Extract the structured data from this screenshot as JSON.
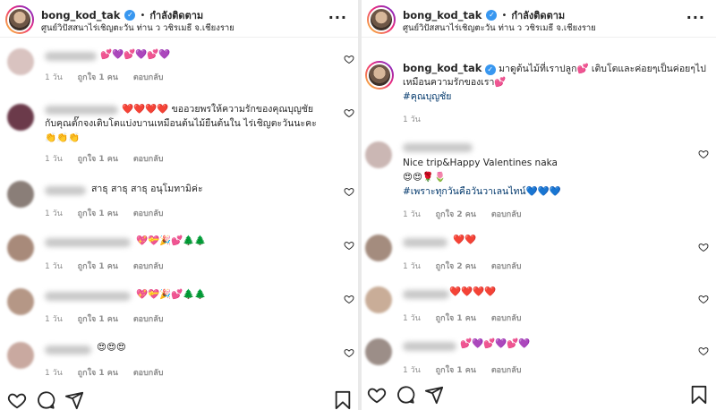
{
  "left": {
    "header": {
      "username": "bong_kod_tak",
      "separator": "•",
      "follow_label": "กำลังติดตาม",
      "location": "ศูนย์วิปัสสนาไร่เชิญตะวัน ท่าน ว วชิรเมธี จ.เชียงราย",
      "more": "···"
    },
    "comments": [
      {
        "text": "💕💜💕💜💕💜",
        "time": "1 วัน",
        "likes": "ถูกใจ 1 คน",
        "reply": "ตอบกลับ"
      },
      {
        "text": "❤️❤️❤️❤️ ขออวยพรให้ความรักของคุณบุญชัย",
        "text2": "กับคุณตั๊กจงเติบโตแบ่งบานเหมือนต้นไม้ยืนต้นใน ไร่เชิญตะวันนะคะ",
        "text3": "👏👏👏",
        "time": "1 วัน",
        "likes": "ถูกใจ 1 คน",
        "reply": "ตอบกลับ"
      },
      {
        "text": "สาธุ สาธุ สาธุ อนุโมทามิค่ะ",
        "time": "1 วัน",
        "likes": "ถูกใจ 1 คน",
        "reply": "ตอบกลับ"
      },
      {
        "text": "💖💝🎉💕🌲🌲",
        "time": "1 วัน",
        "likes": "ถูกใจ 1 คน",
        "reply": "ตอบกลับ"
      },
      {
        "text": "💖💝🎉💕🌲🌲",
        "time": "1 วัน",
        "likes": "ถูกใจ 1 คน",
        "reply": "ตอบกลับ"
      },
      {
        "text": "😍😍😍",
        "time": "1 วัน",
        "likes": "ถูกใจ 1 คน",
        "reply": "ตอบกลับ"
      }
    ]
  },
  "right": {
    "header": {
      "username": "bong_kod_tak",
      "separator": "•",
      "follow_label": "กำลังติดตาม",
      "location": "ศูนย์วิปัสสนาไร่เชิญตะวัน ท่าน ว วชิรเมธี จ.เชียงราย",
      "more": "···"
    },
    "caption": {
      "username": "bong_kod_tak",
      "text": "มาดูต้นไม้ที่เราปลูก💕 เติบโตและค่อยๆเป็นค่อยๆไป",
      "text2": "เหมือนความรักของเรา💕",
      "hashtag": "#คุณบุญชัย",
      "time": "1 วัน"
    },
    "comments": [
      {
        "text": "Nice trip&Happy Valentines naka",
        "text2": "😍😍🌹🌷",
        "hashtag": "#เพราะทุกวันคือวันวาเลนไทน์💙💙💙",
        "time": "1 วัน",
        "likes": "ถูกใจ 2 คน",
        "reply": "ตอบกลับ"
      },
      {
        "text": "❤️❤️",
        "time": "1 วัน",
        "likes": "ถูกใจ 2 คน",
        "reply": "ตอบกลับ"
      },
      {
        "text": "❤️❤️❤️❤️",
        "time": "1 วัน",
        "likes": "ถูกใจ 1 คน",
        "reply": "ตอบกลับ"
      },
      {
        "text": "💕💜💕💜💕💜",
        "time": "1 วัน",
        "likes": "ถูกใจ 1 คน",
        "reply": "ตอบกลับ"
      }
    ]
  },
  "icons": {
    "like": "heart-icon",
    "comment": "comment-icon",
    "share": "share-icon",
    "save": "bookmark-icon",
    "verified": "verified-icon"
  },
  "colors": {
    "verified": "#3897f0",
    "hashtag": "#00376b",
    "meta": "#8e8e8e"
  }
}
